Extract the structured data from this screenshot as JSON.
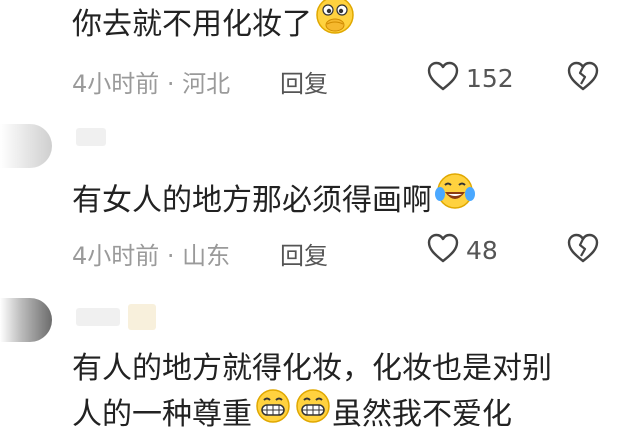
{
  "comments": [
    {
      "text": "你去就不用化妆了",
      "emoji": "hand-over-mouth-emoji",
      "time_location": "4小时前 · 河北",
      "reply_label": "回复",
      "likes": "152"
    },
    {
      "text": "有女人的地方那必须得画啊",
      "emoji": "laughing-tears-emoji",
      "time_location": "4小时前 · 山东",
      "reply_label": "回复",
      "likes": "48"
    },
    {
      "text_line1": "有人的地方就得化妆，化妆也是对别",
      "text_line2_a": "人的一种尊重",
      "text_line2_b": "虽然我不爱化",
      "emoji": "grinning-teeth-emoji"
    }
  ],
  "colors": {
    "text": "#222222",
    "meta": "#9a9a9a",
    "emoji_yellow": "#ffd23f"
  }
}
